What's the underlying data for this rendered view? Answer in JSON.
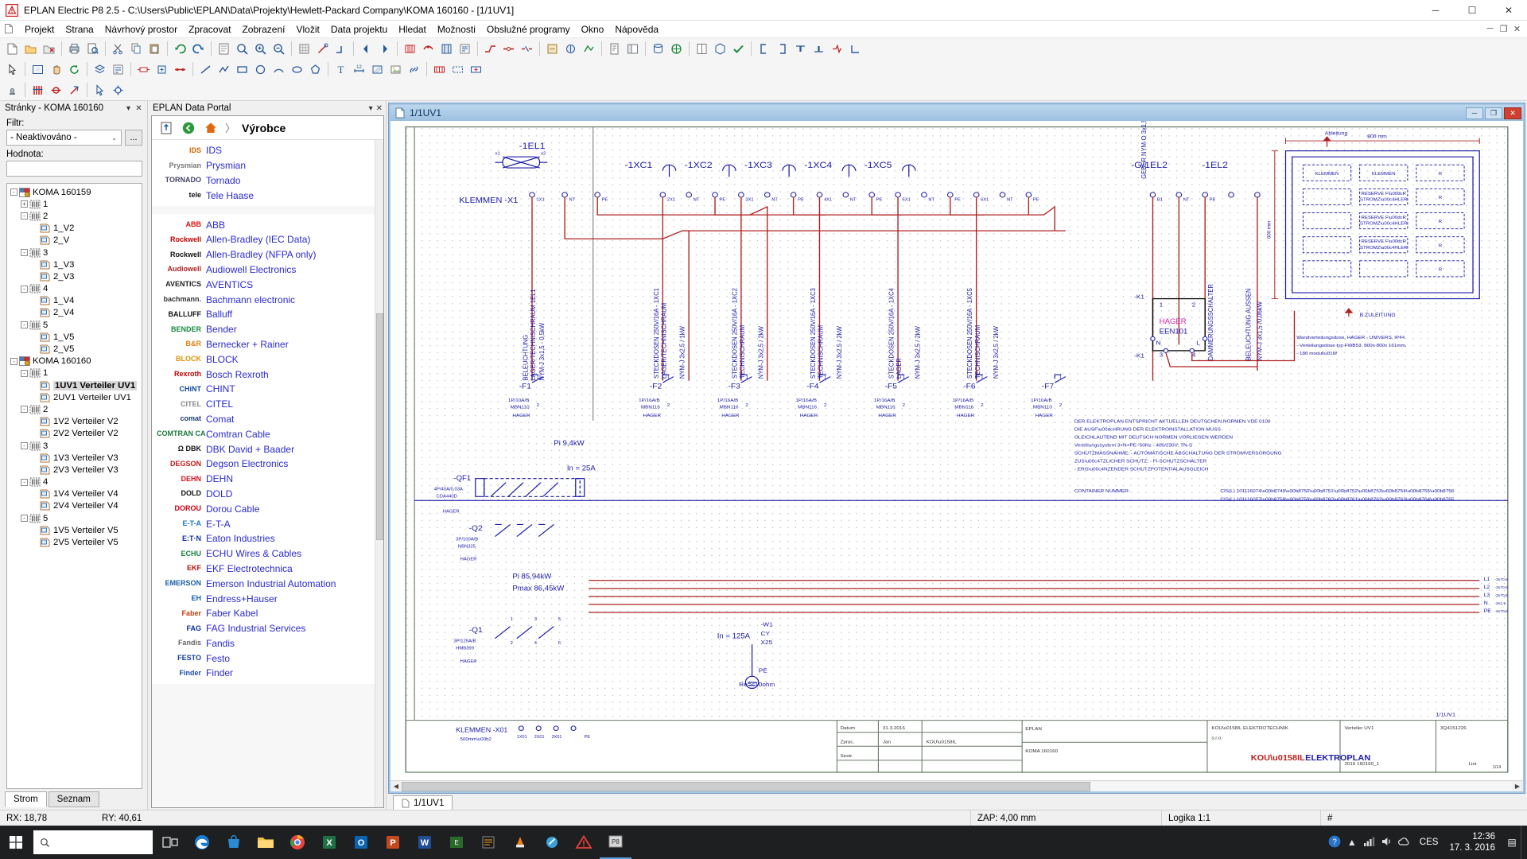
{
  "titlebar": {
    "title": "EPLAN Electric P8 2.5 - C:\\Users\\Public\\EPLAN\\Data\\Projekty\\Hewlett-Packard Company\\KOMA 160160 - [1/1UV1]",
    "minimize": "─",
    "maximize": "☐",
    "close": "✕"
  },
  "menubar": {
    "items": [
      "Projekt",
      "Strana",
      "Návrhový prostor",
      "Zpracovat",
      "Zobrazení",
      "Vložit",
      "Data projektu",
      "Hledat",
      "Možnosti",
      "Obslužné programy",
      "Okno",
      "Nápověda"
    ],
    "mdi_minimize": "─",
    "mdi_restore": "❐",
    "mdi_close": "✕"
  },
  "pages_panel": {
    "title": "Stránky - KOMA 160160",
    "menu_btn": "▾",
    "close_btn": "✕",
    "filter_label": "Filtr:",
    "filter_value": "- Neaktivováno -",
    "filter_arrow": "⌄",
    "dots_button": "...",
    "value_label": "Hodnota:",
    "value_text": "",
    "tree": [
      {
        "indent": 0,
        "exp": "-",
        "icon": "project-icon",
        "label": "KOMA 160159",
        "selected": false
      },
      {
        "indent": 1,
        "exp": "+",
        "icon": "struct-icon",
        "label": "1",
        "selected": false
      },
      {
        "indent": 1,
        "exp": "-",
        "icon": "struct-icon",
        "label": "2",
        "selected": false
      },
      {
        "indent": 2,
        "exp": "",
        "icon": "page-icon",
        "label": "1_V2",
        "selected": false
      },
      {
        "indent": 2,
        "exp": "",
        "icon": "page-icon",
        "label": "2_V",
        "selected": false
      },
      {
        "indent": 1,
        "exp": "-",
        "icon": "struct-icon",
        "label": "3",
        "selected": false
      },
      {
        "indent": 2,
        "exp": "",
        "icon": "page-icon",
        "label": "1_V3",
        "selected": false
      },
      {
        "indent": 2,
        "exp": "",
        "icon": "page-icon",
        "label": "2_V3",
        "selected": false
      },
      {
        "indent": 1,
        "exp": "-",
        "icon": "struct-icon",
        "label": "4",
        "selected": false
      },
      {
        "indent": 2,
        "exp": "",
        "icon": "page-icon",
        "label": "1_V4",
        "selected": false
      },
      {
        "indent": 2,
        "exp": "",
        "icon": "page-icon",
        "label": "2_V4",
        "selected": false
      },
      {
        "indent": 1,
        "exp": "-",
        "icon": "struct-icon",
        "label": "5",
        "selected": false
      },
      {
        "indent": 2,
        "exp": "",
        "icon": "page-icon",
        "label": "1_V5",
        "selected": false
      },
      {
        "indent": 2,
        "exp": "",
        "icon": "page-icon",
        "label": "2_V5",
        "selected": false
      },
      {
        "indent": 0,
        "exp": "-",
        "icon": "project-icon",
        "label": "KOMA 160160",
        "selected": false
      },
      {
        "indent": 1,
        "exp": "-",
        "icon": "struct-icon",
        "label": "1",
        "selected": false
      },
      {
        "indent": 2,
        "exp": "",
        "icon": "page-icon",
        "label": "1UV1 Verteiler UV1",
        "selected": true
      },
      {
        "indent": 2,
        "exp": "",
        "icon": "page-icon",
        "label": "2UV1 Verteiler UV1",
        "selected": false
      },
      {
        "indent": 1,
        "exp": "-",
        "icon": "struct-icon",
        "label": "2",
        "selected": false
      },
      {
        "indent": 2,
        "exp": "",
        "icon": "page-icon",
        "label": "1V2 Verteiler V2",
        "selected": false
      },
      {
        "indent": 2,
        "exp": "",
        "icon": "page-icon",
        "label": "2V2 Verteiler V2",
        "selected": false
      },
      {
        "indent": 1,
        "exp": "-",
        "icon": "struct-icon",
        "label": "3",
        "selected": false
      },
      {
        "indent": 2,
        "exp": "",
        "icon": "page-icon",
        "label": "1V3 Verteiler V3",
        "selected": false
      },
      {
        "indent": 2,
        "exp": "",
        "icon": "page-icon",
        "label": "2V3 Verteiler V3",
        "selected": false
      },
      {
        "indent": 1,
        "exp": "-",
        "icon": "struct-icon",
        "label": "4",
        "selected": false
      },
      {
        "indent": 2,
        "exp": "",
        "icon": "page-icon",
        "label": "1V4 Verteiler V4",
        "selected": false
      },
      {
        "indent": 2,
        "exp": "",
        "icon": "page-icon",
        "label": "2V4 Verteiler V4",
        "selected": false
      },
      {
        "indent": 1,
        "exp": "-",
        "icon": "struct-icon",
        "label": "5",
        "selected": false
      },
      {
        "indent": 2,
        "exp": "",
        "icon": "page-icon",
        "label": "1V5 Verteiler V5",
        "selected": false
      },
      {
        "indent": 2,
        "exp": "",
        "icon": "page-icon",
        "label": "2V5 Verteiler V5",
        "selected": false
      }
    ],
    "tab_tree": "Strom",
    "tab_list": "Seznam"
  },
  "portal": {
    "title": "EPLAN Data Portal",
    "menu_btn": "▾",
    "close_btn": "✕",
    "breadcrumb_sep": "〉",
    "breadcrumb": "Výrobce",
    "groups": [
      {
        "rows": [
          {
            "logo": "IDS",
            "logo_color": "#e06000",
            "name": "IDS"
          },
          {
            "logo": "Prysmian",
            "logo_color": "#777777",
            "name": "Prysmian"
          },
          {
            "logo": "TORNADO",
            "logo_color": "#444466",
            "name": "Tornado"
          },
          {
            "logo": "tele",
            "logo_color": "#111111",
            "name": "Tele Haase"
          }
        ]
      },
      {
        "rows": [
          {
            "logo": "ABB",
            "logo_color": "#e01010",
            "name": "ABB"
          },
          {
            "logo": "Rockwell",
            "logo_color": "#c00000",
            "name": "Allen-Bradley (IEC Data)"
          },
          {
            "logo": "Rockwell",
            "logo_color": "#111111",
            "name": "Allen-Bradley (NFPA only)"
          },
          {
            "logo": "Audiowell",
            "logo_color": "#aa2222",
            "name": "Audiowell Electronics"
          },
          {
            "logo": "AVENTICS",
            "logo_color": "#222222",
            "name": "AVENTICS"
          },
          {
            "logo": "bachmann.",
            "logo_color": "#333333",
            "name": "Bachmann electronic"
          },
          {
            "logo": "BALLUFF",
            "logo_color": "#111111",
            "name": "Balluff"
          },
          {
            "logo": "BENDER",
            "logo_color": "#128a3c",
            "name": "Bender"
          },
          {
            "logo": "B&R",
            "logo_color": "#e08010",
            "name": "Bernecker + Rainer"
          },
          {
            "logo": "BLOCK",
            "logo_color": "#e09000",
            "name": "BLOCK"
          },
          {
            "logo": "Rexroth",
            "logo_color": "#c00000",
            "name": "Bosch Rexroth"
          },
          {
            "logo": "CHiNT",
            "logo_color": "#1048a0",
            "name": "CHINT"
          },
          {
            "logo": "CITEL",
            "logo_color": "#888888",
            "name": "CITEL"
          },
          {
            "logo": "comat",
            "logo_color": "#1a3c78",
            "name": "Comat"
          },
          {
            "logo": "COMTRAN CABLE",
            "logo_color": "#1c7a3c",
            "name": "Comtran Cable"
          },
          {
            "logo": "Ω DBK",
            "logo_color": "#111111",
            "name": "DBK David + Baader"
          },
          {
            "logo": "DEGSON",
            "logo_color": "#c01818",
            "name": "Degson Electronics"
          },
          {
            "logo": "DEHN",
            "logo_color": "#d81020",
            "name": "DEHN"
          },
          {
            "logo": "DOLD",
            "logo_color": "#111111",
            "name": "DOLD"
          },
          {
            "logo": "DOROU",
            "logo_color": "#cc0010",
            "name": "Dorou Cable"
          },
          {
            "logo": "E-T-A",
            "logo_color": "#1a7ac0",
            "name": "E-T-A"
          },
          {
            "logo": "E:T·N",
            "logo_color": "#1030a0",
            "name": "Eaton Industries"
          },
          {
            "logo": "ECHU",
            "logo_color": "#18823c",
            "name": "ECHU Wires & Cables"
          },
          {
            "logo": "EKF",
            "logo_color": "#c01010",
            "name": "EKF Electrotechnica"
          },
          {
            "logo": "EMERSON",
            "logo_color": "#1a5ca8",
            "name": "Emerson Industrial Automation"
          },
          {
            "logo": "EH",
            "logo_color": "#1060b0",
            "name": "Endress+Hauser"
          },
          {
            "logo": "Faber",
            "logo_color": "#c04010",
            "name": "Faber Kabel"
          },
          {
            "logo": "FAG",
            "logo_color": "#1030a0",
            "name": "FAG Industrial Services"
          },
          {
            "logo": "Fandis",
            "logo_color": "#666666",
            "name": "Fandis"
          },
          {
            "logo": "FESTO",
            "logo_color": "#1040a0",
            "name": "Festo"
          },
          {
            "logo": "Finder",
            "logo_color": "#1a4ca8",
            "name": "Finder"
          }
        ]
      }
    ]
  },
  "drawing": {
    "window_title": "1/1UV1",
    "win_minimize": "─",
    "win_restore": "❐",
    "win_close": "✕",
    "page_tab": "1/1UV1",
    "scroll_left": "◀",
    "scroll_right": "▶",
    "labels": {
      "el1": "-1EL1",
      "xc": [
        "-1XC1",
        "-1XC2",
        "-1XC3",
        "-1XC4",
        "-1XC5"
      ],
      "geber": "GEBER NYM-O 3x1,5",
      "g1el2": "-G/1EL2",
      "el2": "-1EL2",
      "klemmen_x1": "KLEMMEN -X1",
      "klemmen_x01": "KLEMMEN -X01",
      "klemmen_sub": "500mm²",
      "terminal_row": [
        "1X1",
        "NT",
        "PE",
        "2X1",
        "NT",
        "PE",
        "3X1",
        "NT",
        "PE",
        "4X1",
        "NT",
        "PE",
        "5X1",
        "NT",
        "PE",
        "6X1",
        "NT",
        "PE"
      ],
      "vert_texts": [
        "BELEUCHTUNG LAGER/TECHNISCHRAUM 1EL1",
        "NYM-J  3x1,5  - 0,5kW",
        "STECKDOSEN 250V/16A - 1XC1",
        "LAGER/TECHNISCHRAUM",
        "NYM-J  3x2,5  / 1kW",
        "STECKDOSEN 250V/16A - 1XC2",
        "TECHNISCHRAUM",
        "NYM-J  3x2,5  / 2kW",
        "STECKDOSEN 250V/16A - 1XC3",
        "TECHNISCHRAUM",
        "NYM-J  3x2,5  / 2kW",
        "STECKDOSEN 250V/16A - 1XC4",
        "LAGER",
        "NYM-J  3x2,5  / 2kW",
        "STECKDOSEN 250V/16A - 1XC5",
        "TECHNISCHRAUM",
        "NYM-J  3x2,5  / 2kW",
        "DAMMERUNGSSCHALTER",
        "BELEUCHTUNG AUSSEN",
        "NYM-J  3x1,5  /0,06kW"
      ],
      "fuses": [
        {
          "tag": "-F1",
          "spec": "1P/10A/B",
          "type": "MBN110",
          "mfr": "HAGER"
        },
        {
          "tag": "-F2",
          "spec": "1P/16A/B",
          "type": "MBN116",
          "mfr": "HAGER"
        },
        {
          "tag": "-F3",
          "spec": "1P/16A/B",
          "type": "MBN116",
          "mfr": "HAGER"
        },
        {
          "tag": "-F4",
          "spec": "1P/16A/B",
          "type": "MBN116",
          "mfr": "HAGER"
        },
        {
          "tag": "-F5",
          "spec": "1P/16A/B",
          "type": "MBN116",
          "mfr": "HAGER"
        },
        {
          "tag": "-F6",
          "spec": "1P/16A/B",
          "type": "MBN116",
          "mfr": "HAGER"
        },
        {
          "tag": "-F7",
          "spec": "1P/10A/B",
          "type": "MBN110",
          "mfr": "HAGER"
        }
      ],
      "k1_tag": "-K1",
      "k1_mfr": "HAGER",
      "k1_type": "EEN101",
      "k1_term_n": "N",
      "k1_term_l": "L",
      "k1_terms": [
        "1",
        "2",
        "3",
        "4"
      ],
      "qf1": {
        "tag": "-QF1",
        "spec": "4P/40A/0,03A",
        "type": "CDA440D",
        "mfr": "HAGER"
      },
      "q2": {
        "tag": "-Q2",
        "spec": "3P/100A/B",
        "type": "NBN325",
        "mfr": "HAGER"
      },
      "q1": {
        "tag": "-Q1",
        "spec": "3P/125A/B",
        "type": "HMB399",
        "mfr": "HAGER"
      },
      "in25": "In = 25A",
      "in125": "In = 125A",
      "pi_94": "Pi 9,4kW",
      "pi_85": "Pi 85,94kW",
      "pmax": "Pmax 86,45kW",
      "w1": "-W1",
      "w1_type": "CY",
      "w1_size": "X25",
      "pe_label": "PE",
      "re_label": "Re=<10ohm",
      "outgoing": [
        "L1  - 3x70,6",
        "L2  - 3x70,6",
        "L3  - 3x70,6",
        "N  - 3x1,9",
        "PE  - 3x70,6"
      ],
      "ableitung": "Ableitung",
      "dim_800": "800 mm",
      "dim_600": "600 mm",
      "bzuleitung": "B.ZULEITUNG",
      "panel_cells": [
        [
          "KLEMMEN",
          "KLEMMEN",
          "R"
        ],
        [
          "",
          "RESERVE FÜR\nSTROMZÄHLER",
          "R"
        ],
        [
          "",
          "RESERVE FÜR\nSTROMZÄHLER",
          "R"
        ],
        [
          "",
          "RESERVE FÜR\nSTROMZÄHLER",
          "R"
        ],
        [
          "",
          "",
          "R"
        ]
      ],
      "notes_right": [
        "Wandverteilungsdose, HAGER - UNIVERS, IP44",
        "- Verteilungsdose typ FWB53,  800x 800x 161mm,",
        "- 180 modulů"
      ],
      "notes_block": [
        "DER ELEKTROPLAN ENTSPRICHT AKTUELLEN DEUTSCHEN NORMEN VDE 0100",
        "DIE AUSFÜHRUNG DER ELEKTROINSTALLATION MUSS",
        "GLEICHLAUTEND MIT DEUTSCH NORMEN VORLIEGEN WERDEN",
        "Verteilungssystem 3+N+PE~50Hz - 400/230V; TN-S",
        "SCHUTZMASSNAHME:          - AUTOMATISCHE ABSCHALTUNG DER STROMVERSORGUNG",
        "ZUSÄTZLICHER SCHUTZ:      - FI-SCHUTZSCHALTER",
        "                                        - ERGÄNZENDER SCHUTZPOTENTIALAUSGLEICH"
      ],
      "container_label": "CONTAINER NUMMER:",
      "container_values": [
        "CIS(L) 101116074¸749¸750¸751¸752¸753¸754¸755¸756",
        "CIS(L) 101116057¸758¸759¸760¸761¸762¸763¸764¸765"
      ],
      "titleblock": {
        "datum_label": "Datum",
        "datum": "31.3.2016",
        "zprac_label": "Zprac.",
        "zprac": "KOUŘIL",
        "zpr_abbr": "Jan",
        "sestr_label": "Sestr.",
        "firm": "EPLAN",
        "project": "KOMA 160160",
        "company": "KOUŘIL ELEKTROTECHNIK s.r.o.",
        "doc_title": "Verteiler UV1",
        "drawing_no": "3Q4151226",
        "kouril": "KOUŘIL",
        "elektroplan": "ELEKTROPLAN",
        "file": "2016 160160_1",
        "page_right": "1/1UV1",
        "list_label": "List",
        "list_value": "1/14"
      }
    }
  },
  "statusbar": {
    "rx": "RX: 18,78",
    "ry": "RY: 40,61",
    "zap": "ZAP: 4,00 mm",
    "logic": "Logika 1:1",
    "hash": "#"
  },
  "taskbar": {
    "start": "⊞",
    "search_placeholder": "",
    "icons": [
      "task-view-icon",
      "edge-icon",
      "store-icon",
      "folder-icon",
      "chrome-icon",
      "excel-icon",
      "outlook-icon",
      "powerpoint-icon",
      "word-icon",
      "eplan-icon",
      "note-icon",
      "vlc-icon",
      "tool-icon",
      "warning-icon",
      "eplan2-icon"
    ],
    "tray_up": "▲",
    "tray_network": "📶",
    "tray_volume": "🔊",
    "tray_cloud": "☁",
    "language": "CES",
    "time": "12:36",
    "date": "17. 3. 2016",
    "notif": "▤"
  }
}
